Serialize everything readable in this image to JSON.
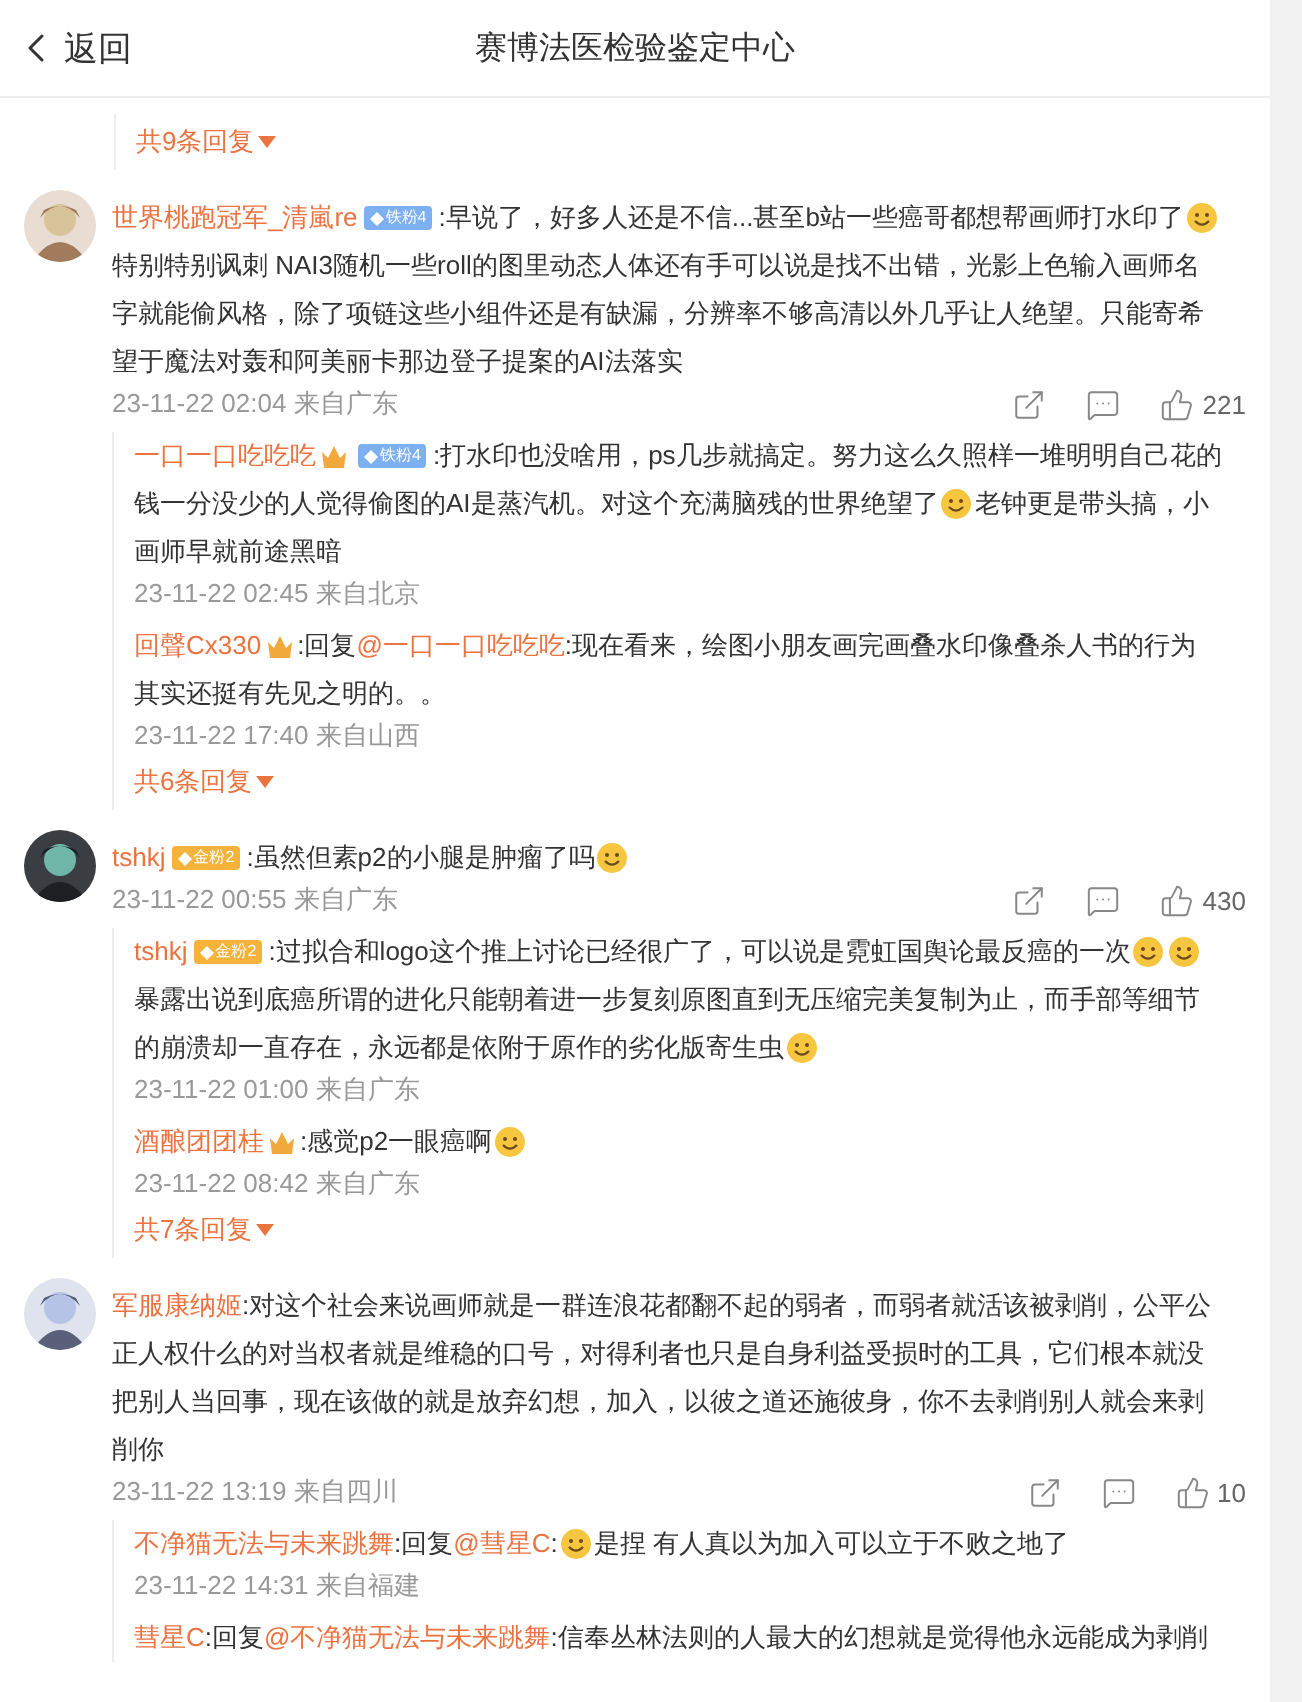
{
  "header": {
    "back_label": "返回",
    "title": "赛博法医检验鉴定中心"
  },
  "comments": [
    {
      "kind": "continued",
      "reply_count_link": "共9条回复"
    },
    {
      "kind": "full",
      "lines": [
        [
          {
            "kind": "user",
            "text": "世界桃跑冠军_清嵐re"
          },
          {
            "kind": "badge",
            "color": "#7cb0f0",
            "text": "铁粉4"
          },
          {
            "kind": "text",
            "text": ":早说了，好多人还是不信...甚至b站一些癌哥都想帮画师打水印了"
          },
          {
            "kind": "emoji"
          }
        ],
        [
          {
            "kind": "text",
            "text": "特别特别讽刺 NAI3随机一些roll的图里动态人体还有手可以说是找不出错，光影上色输入画师名"
          }
        ],
        [
          {
            "kind": "text",
            "text": "字就能偷风格，除了项链这些小组件还是有缺漏，分辨率不够高清以外几乎让人绝望。只能寄希"
          }
        ],
        [
          {
            "kind": "text",
            "text": "望于魔法对轰和阿美丽卡那边登子提案的AI法落实"
          }
        ]
      ],
      "time": "23-11-22 02:04 来自广东",
      "likes": "221",
      "replies": [
        {
          "lines": [
            [
              {
                "kind": "user",
                "text": "一口一口吃吃吃"
              },
              {
                "kind": "crown"
              },
              {
                "kind": "badge",
                "color": "#7cb0f0",
                "text": "铁粉4"
              },
              {
                "kind": "text",
                "text": ":打水印也没啥用，ps几步就搞定。努力这么久照样一堆明明自己花的"
              }
            ],
            [
              {
                "kind": "text",
                "text": "钱一分没少的人觉得偷图的AI是蒸汽机。对这个充满脑残的世界绝望了"
              },
              {
                "kind": "emoji"
              },
              {
                "kind": "text",
                "text": "老钟更是带头搞，小"
              }
            ],
            [
              {
                "kind": "text",
                "text": "画师早就前途黑暗"
              }
            ]
          ],
          "time": "23-11-22 02:45 来自北京"
        },
        {
          "lines": [
            [
              {
                "kind": "user",
                "text": "回聲Cx330"
              },
              {
                "kind": "crown"
              },
              {
                "kind": "text",
                "text": ":回复"
              },
              {
                "kind": "mention",
                "text": "@一口一口吃吃吃"
              },
              {
                "kind": "text",
                "text": ":现在看来，绘图小朋友画完画叠水印像叠杀人书的行为"
              }
            ],
            [
              {
                "kind": "text",
                "text": "其实还挺有先见之明的。。"
              }
            ]
          ],
          "time": "23-11-22 17:40 来自山西"
        }
      ],
      "reply_count_link": "共6条回复"
    },
    {
      "kind": "full",
      "lines": [
        [
          {
            "kind": "user",
            "text": "tshkj"
          },
          {
            "kind": "badge",
            "color": "#f5b33b",
            "text": "金粉2"
          },
          {
            "kind": "text",
            "text": ":虽然但素p2的小腿是肿瘤了吗"
          },
          {
            "kind": "emoji"
          }
        ]
      ],
      "time": "23-11-22 00:55 来自广东",
      "likes": "430",
      "replies": [
        {
          "lines": [
            [
              {
                "kind": "user",
                "text": "tshkj"
              },
              {
                "kind": "badge",
                "color": "#f5b33b",
                "text": "金粉2"
              },
              {
                "kind": "text",
                "text": ":过拟合和logo这个推上讨论已经很广了，可以说是霓虹国舆论最反癌的一次"
              },
              {
                "kind": "emoji"
              },
              {
                "kind": "emoji"
              }
            ],
            [
              {
                "kind": "text",
                "text": "暴露出说到底癌所谓的进化只能朝着进一步复刻原图直到无压缩完美复制为止，而手部等细节"
              }
            ],
            [
              {
                "kind": "text",
                "text": "的崩溃却一直存在，永远都是依附于原作的劣化版寄生虫"
              },
              {
                "kind": "emoji"
              }
            ]
          ],
          "time": "23-11-22 01:00 来自广东"
        },
        {
          "lines": [
            [
              {
                "kind": "user",
                "text": "酒酿团团桂"
              },
              {
                "kind": "crown"
              },
              {
                "kind": "text",
                "text": ":感觉p2一眼癌啊"
              },
              {
                "kind": "emoji"
              }
            ]
          ],
          "time": "23-11-22 08:42 来自广东"
        }
      ],
      "reply_count_link": "共7条回复"
    },
    {
      "kind": "full",
      "lines": [
        [
          {
            "kind": "user",
            "text": "军服康纳姬"
          },
          {
            "kind": "text",
            "text": ":对这个社会来说画师就是一群连浪花都翻不起的弱者，而弱者就活该被剥削，公平公"
          }
        ],
        [
          {
            "kind": "text",
            "text": "正人权什么的对当权者就是维稳的口号，对得利者也只是自身利益受损时的工具，它们根本就没"
          }
        ],
        [
          {
            "kind": "text",
            "text": "把别人当回事，现在该做的就是放弃幻想，加入，以彼之道还施彼身，你不去剥削别人就会来剥"
          }
        ],
        [
          {
            "kind": "text",
            "text": "削你"
          }
        ]
      ],
      "time": "23-11-22 13:19 来自四川",
      "likes": "10",
      "replies": [
        {
          "lines": [
            [
              {
                "kind": "user",
                "text": "不净猫无法与未来跳舞"
              },
              {
                "kind": "text",
                "text": ":回复"
              },
              {
                "kind": "mention",
                "text": "@彗星C"
              },
              {
                "kind": "text",
                "text": ":"
              },
              {
                "kind": "emoji"
              },
              {
                "kind": "text",
                "text": "是捏 有人真以为加入可以立于不败之地了"
              }
            ]
          ],
          "time": "23-11-22 14:31 来自福建"
        },
        {
          "lines": [
            [
              {
                "kind": "user",
                "text": "彗星C"
              },
              {
                "kind": "text",
                "text": ":回复"
              },
              {
                "kind": "mention",
                "text": "@不净猫无法与未来跳舞"
              },
              {
                "kind": "text",
                "text": ":信奉丛林法则的人最大的幻想就是觉得他永远能成为剥削"
              }
            ]
          ]
        }
      ]
    }
  ]
}
